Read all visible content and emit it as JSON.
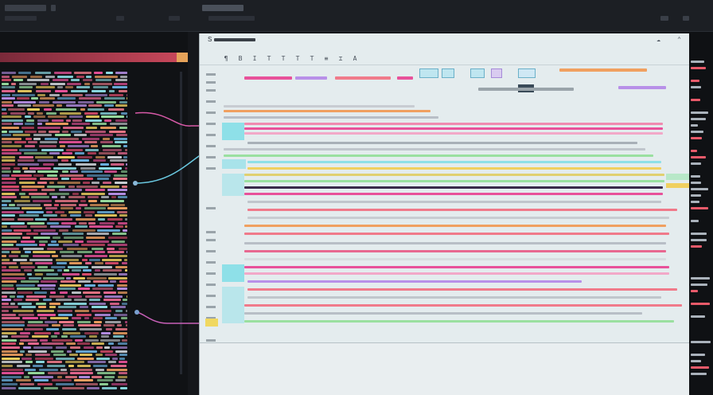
{
  "window": {
    "title": "S",
    "right_label": "≤ 16"
  },
  "document": {
    "title": "S",
    "close_icon": "close-icon",
    "cloud_icon": "cloud-icon"
  },
  "toolbar": {
    "tools": [
      "¶",
      "B",
      "I",
      "T",
      "T",
      "T",
      "T",
      "≡",
      "⌶",
      "A"
    ]
  },
  "chips": [
    "",
    "",
    ""
  ],
  "colors": {
    "accent_pink": "#e8519a",
    "accent_cyan": "#8ee0e8",
    "accent_yellow": "#f0d860",
    "doc_bg": "#e4ecee",
    "pane_bg": "#101215"
  }
}
